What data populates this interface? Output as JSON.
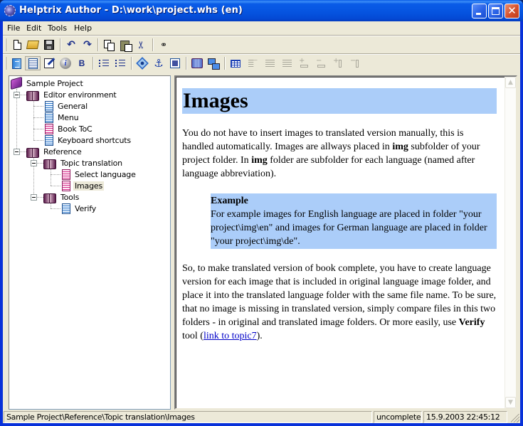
{
  "window": {
    "title": "Helptrix Author - D:\\work\\project.whs (en)",
    "minimize_label": "Minimize",
    "maximize_label": "Maximize",
    "close_label": "Close"
  },
  "menu": [
    "File",
    "Edit",
    "Tools",
    "Help"
  ],
  "toolbar1": [
    {
      "name": "new",
      "icon": "new-document-icon"
    },
    {
      "name": "open",
      "icon": "open-folder-icon"
    },
    {
      "name": "save",
      "icon": "save-icon"
    },
    {
      "name": "undo",
      "icon": "undo-icon",
      "glyph": "↶"
    },
    {
      "name": "redo",
      "icon": "redo-icon",
      "glyph": "↷"
    },
    {
      "name": "copy",
      "icon": "copy-icon"
    },
    {
      "name": "paste",
      "icon": "paste-icon"
    },
    {
      "name": "cut",
      "icon": "cut-icon",
      "glyph": "✂"
    },
    {
      "name": "find",
      "icon": "binoculars-icon",
      "glyph": "⚲"
    }
  ],
  "toolbar2": [
    {
      "name": "project-properties",
      "icon": "project-properties-icon"
    },
    {
      "name": "source-view",
      "icon": "source-view-icon",
      "pressed": true
    },
    {
      "name": "edit-topic",
      "icon": "edit-topic-icon"
    },
    {
      "name": "info",
      "icon": "info-icon",
      "glyph": "i"
    },
    {
      "name": "bold",
      "icon": "bold-icon",
      "glyph": "B"
    },
    {
      "name": "bullet-list",
      "icon": "bullet-list-icon"
    },
    {
      "name": "numbered-list",
      "icon": "numbered-list-icon"
    },
    {
      "name": "insert-link",
      "icon": "link-target-icon"
    },
    {
      "name": "insert-anchor",
      "icon": "anchor-icon",
      "glyph": "⚓"
    },
    {
      "name": "insert-image",
      "icon": "insert-image-icon"
    },
    {
      "name": "compile-book",
      "icon": "book-icon"
    },
    {
      "name": "publish",
      "icon": "network-icon"
    },
    {
      "name": "insert-table",
      "icon": "table-icon"
    },
    {
      "name": "align-left",
      "icon": "align-left-icon",
      "disabled": true
    },
    {
      "name": "align-center",
      "icon": "align-center-icon",
      "disabled": true
    },
    {
      "name": "align-right",
      "icon": "align-right-icon",
      "disabled": true
    },
    {
      "name": "insert-row",
      "icon": "insert-row-icon",
      "disabled": true
    },
    {
      "name": "delete-row",
      "icon": "delete-row-icon",
      "disabled": true
    },
    {
      "name": "insert-column",
      "icon": "insert-column-icon",
      "disabled": true
    },
    {
      "name": "delete-column",
      "icon": "delete-column-icon",
      "disabled": true
    }
  ],
  "tree": {
    "root": "Sample Project",
    "items": [
      {
        "label": "Editor environment",
        "type": "book"
      },
      {
        "label": "General",
        "type": "page-blue"
      },
      {
        "label": "Menu",
        "type": "page-blue"
      },
      {
        "label": "Book ToC",
        "type": "page-pink"
      },
      {
        "label": "Keyboard shortcuts",
        "type": "page-blue"
      },
      {
        "label": "Reference",
        "type": "book"
      },
      {
        "label": "Topic translation",
        "type": "book"
      },
      {
        "label": "Select language",
        "type": "page-pink"
      },
      {
        "label": "Images",
        "type": "page-pink",
        "selected": true
      },
      {
        "label": "Tools",
        "type": "book"
      },
      {
        "label": "Verify",
        "type": "page-blue"
      }
    ]
  },
  "content": {
    "heading": "Images",
    "para1": {
      "t1": "You do not have to insert images to translated version manually, this is handled automatically. Images are allways placed in ",
      "b1": "img",
      "t2": " subfolder of your project folder. In ",
      "b2": "img",
      "t3": " folder are subfolder for each language (named after language abbreviation)."
    },
    "example": {
      "title": "Example",
      "text": "For example images for English language are placed in folder \"your project\\img\\en\" and images for German language are placed in folder \"your project\\img\\de\"."
    },
    "para2": {
      "t1": "So, to make translated version of book complete, you have to create language version for each image that is included in original language image folder, and place it into the translated language folder with the same file name. To be sure, that no image is missing in translated version, simply compare files in this two folders - in original and translated image folders. Or more easily, use ",
      "b1": "Verify",
      "t2": " tool (",
      "link": "link to topic7",
      "t3": ")."
    },
    "colors": {
      "highlight": "#abcdf9",
      "link": "#0000c8"
    }
  },
  "statusbar": {
    "path": "Sample Project\\Reference\\Topic translation\\Images",
    "state": "uncomplete",
    "timestamp": "15.9.2003 22:45:12"
  }
}
